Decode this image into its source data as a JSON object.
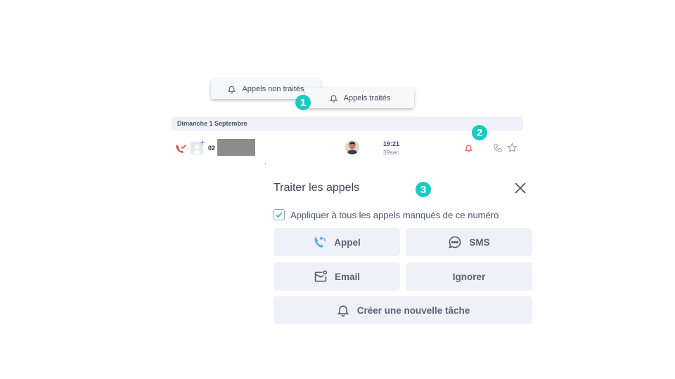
{
  "tabs": {
    "unprocessed_label": "Appels non traités",
    "processed_label": "Appels traités"
  },
  "markers": [
    "1",
    "2",
    "3"
  ],
  "call_list": {
    "date_header": "Dimanche 1 Septembre",
    "row": {
      "number_prefix": "02",
      "time": "19:21",
      "duration": "39sec"
    }
  },
  "panel": {
    "title": "Traiter les appels",
    "apply_all_label": "Appliquer à tous les appels manqués de ce numéro",
    "apply_all_checked": true,
    "buttons": {
      "call": "Appel",
      "sms": "SMS",
      "email": "Email",
      "ignore": "Ignorer",
      "new_task": "Créer une nouvelle tâche"
    }
  },
  "colors": {
    "accent_teal": "#1cc9c3",
    "missed_red": "#e24c4b",
    "call_blue": "#5ab4e5",
    "button_bg": "#eef1f7"
  },
  "icons": [
    "bell-icon",
    "missed-call-icon",
    "phone-icon",
    "star-icon",
    "close-icon",
    "callback-icon",
    "chat-bubble-icon",
    "email-icon",
    "checkmark-icon"
  ]
}
